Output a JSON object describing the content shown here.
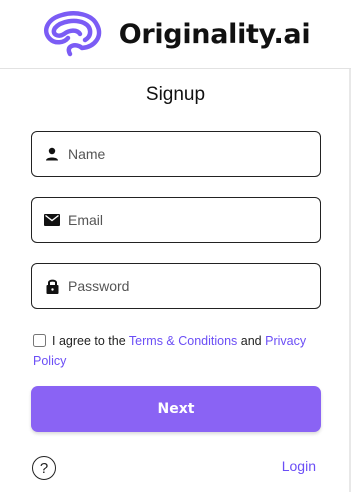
{
  "brand": {
    "name": "Originality.ai",
    "logo_icon": "brain-logo-icon",
    "accent": "#7b5cf5"
  },
  "form": {
    "title": "Signup",
    "name_placeholder": "Name",
    "email_placeholder": "Email",
    "password_placeholder": "Password",
    "agree_prefix": "I agree to the ",
    "terms_link": "Terms & Conditions",
    "agree_and": " and ",
    "privacy_link": "Privacy Policy",
    "next_label": "Next",
    "next_color": "#8a63f4"
  },
  "footer": {
    "help_symbol": "?",
    "login_label": "Login"
  }
}
